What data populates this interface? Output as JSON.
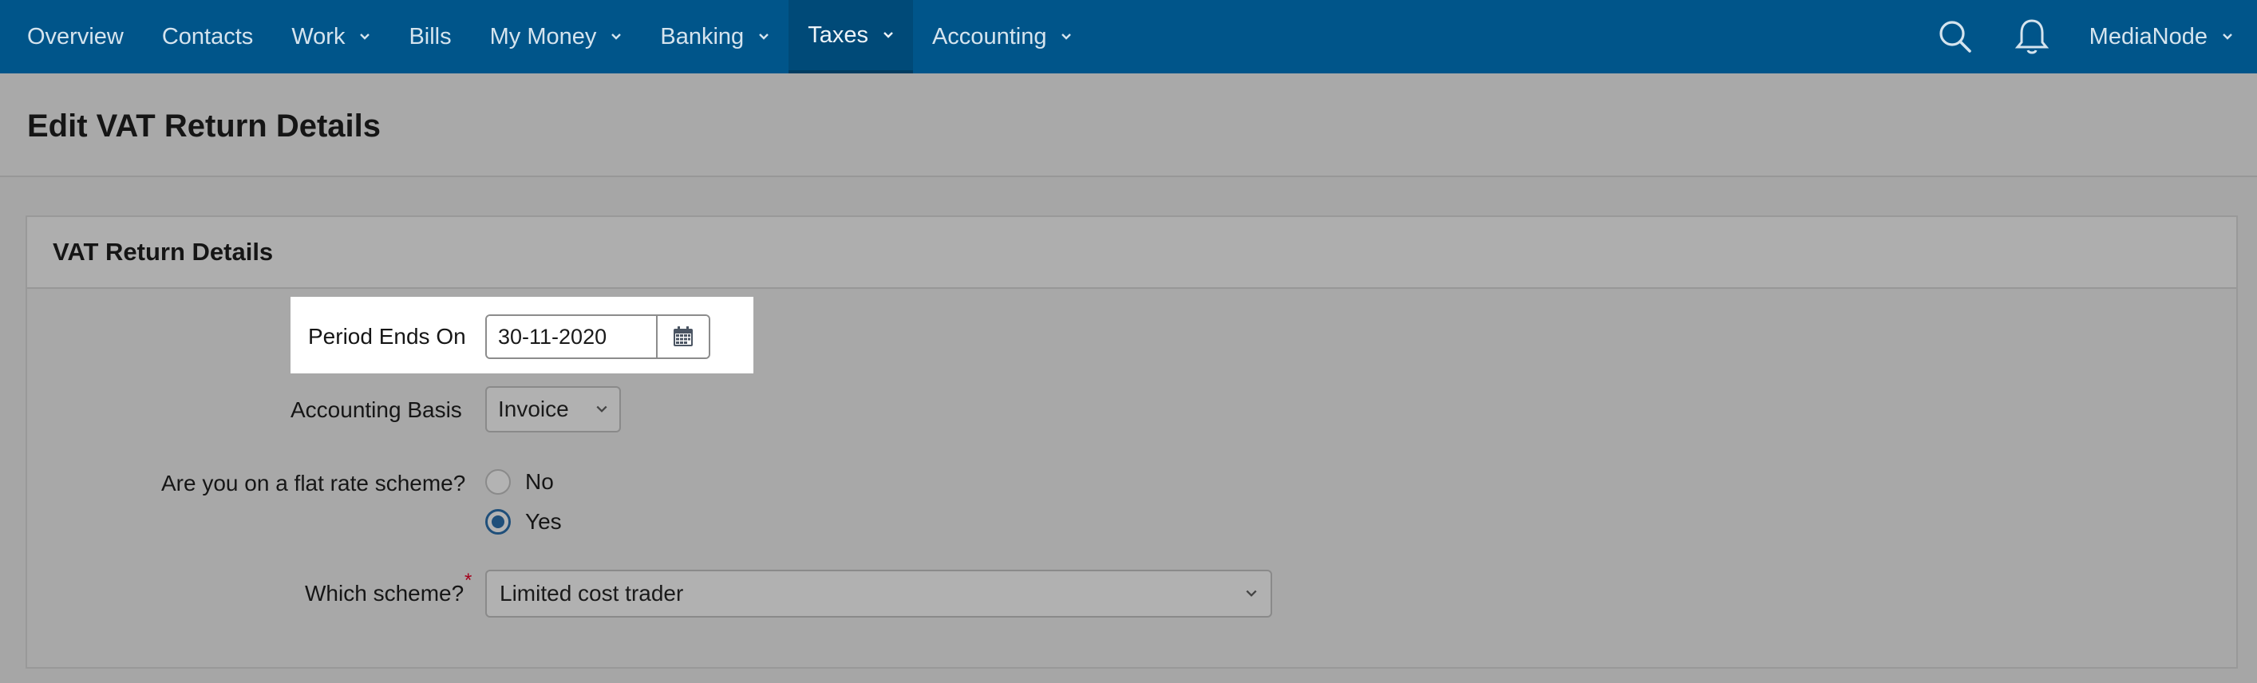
{
  "nav": {
    "items": [
      {
        "label": "Overview",
        "dropdown": false
      },
      {
        "label": "Contacts",
        "dropdown": false
      },
      {
        "label": "Work",
        "dropdown": true
      },
      {
        "label": "Bills",
        "dropdown": false
      },
      {
        "label": "My Money",
        "dropdown": true
      },
      {
        "label": "Banking",
        "dropdown": true
      },
      {
        "label": "Taxes",
        "dropdown": true,
        "active": true
      },
      {
        "label": "Accounting",
        "dropdown": true
      }
    ],
    "account_label": "MediaNode",
    "icons": [
      "search-icon",
      "bell-icon",
      "chevron-down-icon"
    ]
  },
  "page": {
    "title": "Edit VAT Return Details"
  },
  "panel": {
    "title": "VAT Return Details",
    "period_label": "Period Ends On",
    "period_value": "30-11-2020",
    "basis_label": "Accounting Basis",
    "basis_value": "Invoice",
    "flat_rate_label": "Are you on a flat rate scheme?",
    "radio_no": "No",
    "radio_yes": "Yes",
    "flat_rate_selected": "Yes",
    "scheme_label": "Which scheme?",
    "scheme_required_mark": "*",
    "scheme_value": "Limited cost trader"
  },
  "colors": {
    "nav_bg": "#00558a",
    "nav_active_bg": "#004a78",
    "overlay_bg": "#a6a6a6",
    "required": "#a3001b"
  }
}
